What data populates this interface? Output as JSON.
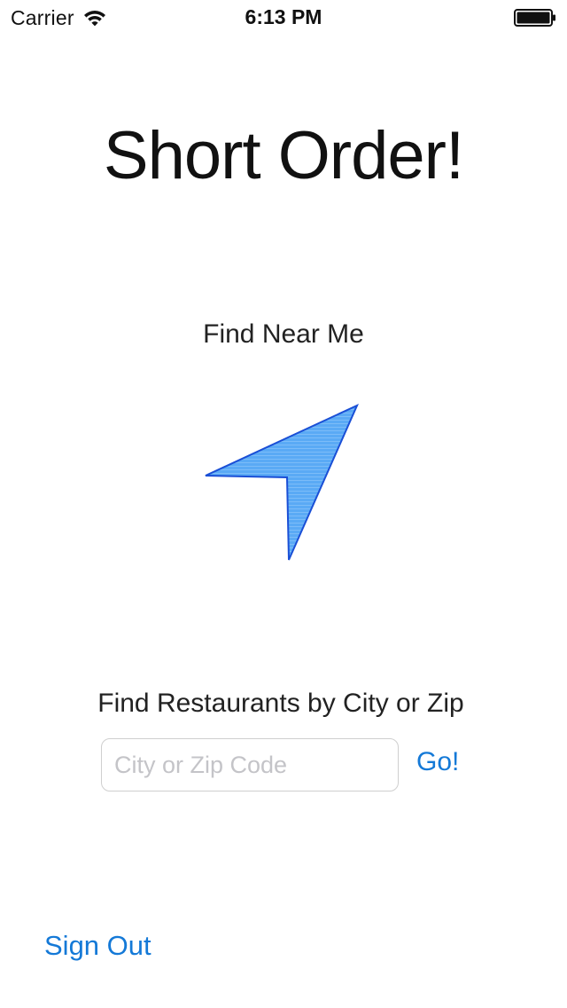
{
  "status_bar": {
    "carrier": "Carrier",
    "time": "6:13 PM",
    "wifi_icon": "wifi-icon",
    "battery_icon": "battery-icon"
  },
  "title": "Short Order!",
  "near_me": {
    "label": "Find Near Me",
    "icon": "location-arrow-icon",
    "icon_fill": "#5aaaf5",
    "icon_stroke": "#1a4fd6"
  },
  "search": {
    "label": "Find Restaurants by City or Zip",
    "value": "",
    "placeholder": "City or Zip Code",
    "go_label": "Go!"
  },
  "sign_out_label": "Sign Out",
  "colors": {
    "accent": "#1479d7",
    "background": "#ffffff"
  }
}
